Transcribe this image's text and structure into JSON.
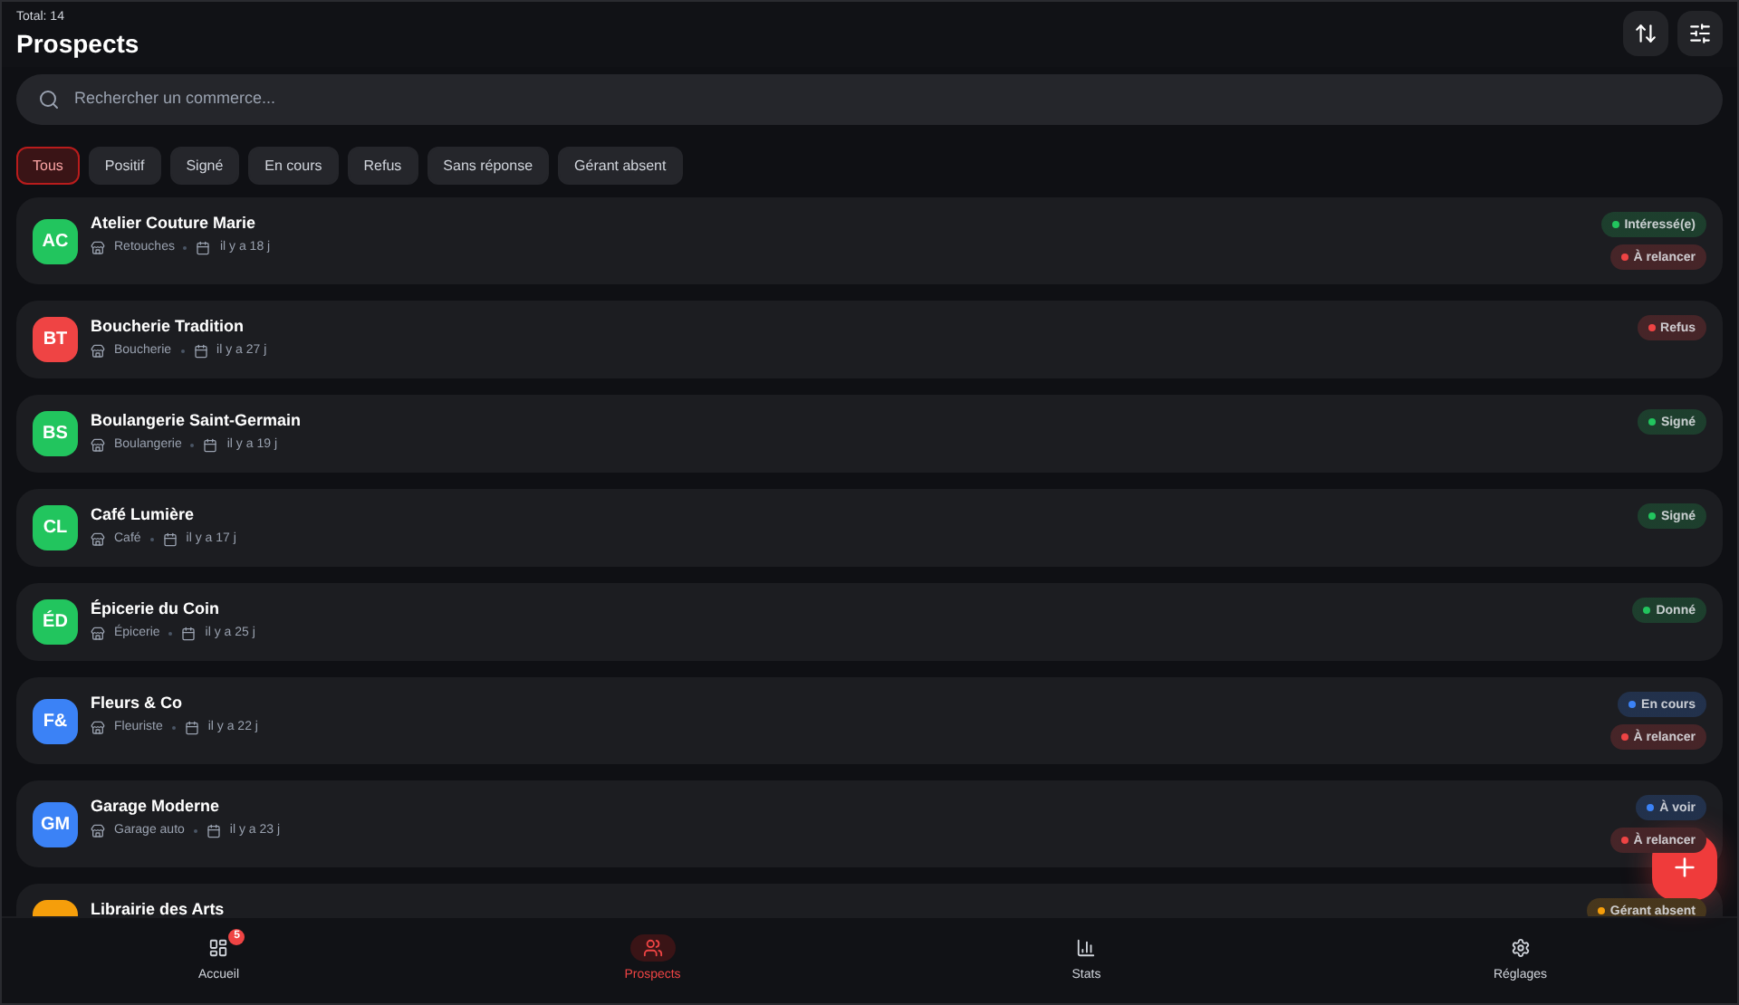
{
  "header": {
    "total": "Total: 14",
    "title": "Prospects"
  },
  "search": {
    "placeholder": "Rechercher un commerce..."
  },
  "filters": [
    {
      "label": "Tous",
      "selected": true
    },
    {
      "label": "Positif",
      "selected": false
    },
    {
      "label": "Signé",
      "selected": false
    },
    {
      "label": "En cours",
      "selected": false
    },
    {
      "label": "Refus",
      "selected": false
    },
    {
      "label": "Sans réponse",
      "selected": false
    },
    {
      "label": "Gérant absent",
      "selected": false
    }
  ],
  "prospects": [
    {
      "initials": "AC",
      "color": "#22c55e",
      "name": "Atelier Couture Marie",
      "category": "Retouches",
      "age": "il y a 18 j",
      "badges": [
        {
          "label": "Intéressé(e)",
          "color": "#22c55e"
        },
        {
          "label": "À relancer",
          "color": "#ef4444"
        }
      ]
    },
    {
      "initials": "BT",
      "color": "#ef4444",
      "name": "Boucherie Tradition",
      "category": "Boucherie",
      "age": "il y a 27 j",
      "badges": [
        {
          "label": "Refus",
          "color": "#ef4444"
        }
      ]
    },
    {
      "initials": "BS",
      "color": "#22c55e",
      "name": "Boulangerie Saint-Germain",
      "category": "Boulangerie",
      "age": "il y a 19 j",
      "badges": [
        {
          "label": "Signé",
          "color": "#22c55e"
        }
      ]
    },
    {
      "initials": "CL",
      "color": "#22c55e",
      "name": "Café Lumière",
      "category": "Café",
      "age": "il y a 17 j",
      "badges": [
        {
          "label": "Signé",
          "color": "#22c55e"
        }
      ]
    },
    {
      "initials": "ÉD",
      "color": "#22c55e",
      "name": "Épicerie du Coin",
      "category": "Épicerie",
      "age": "il y a 25 j",
      "badges": [
        {
          "label": "Donné",
          "color": "#22c55e"
        }
      ]
    },
    {
      "initials": "F&",
      "color": "#3b82f6",
      "name": "Fleurs & Co",
      "category": "Fleuriste",
      "age": "il y a 22 j",
      "badges": [
        {
          "label": "En cours",
          "color": "#3b82f6"
        },
        {
          "label": "À relancer",
          "color": "#ef4444"
        }
      ]
    },
    {
      "initials": "GM",
      "color": "#3b82f6",
      "name": "Garage Moderne",
      "category": "Garage auto",
      "age": "il y a 23 j",
      "badges": [
        {
          "label": "À voir",
          "color": "#3b82f6"
        },
        {
          "label": "À relancer",
          "color": "#ef4444"
        }
      ]
    },
    {
      "color": "#f59e0b",
      "name": "Librairie des Arts",
      "badges": [
        {
          "label": "Gérant absent",
          "color": "#f59e0b"
        }
      ]
    }
  ],
  "nav": [
    {
      "kind": "home",
      "label": "Accueil",
      "count": "5",
      "selected": false
    },
    {
      "kind": "prospects",
      "label": "Prospects",
      "selected": true
    },
    {
      "kind": "stats",
      "label": "Stats",
      "selected": false
    },
    {
      "kind": "settings",
      "label": "Réglages",
      "selected": false
    }
  ]
}
